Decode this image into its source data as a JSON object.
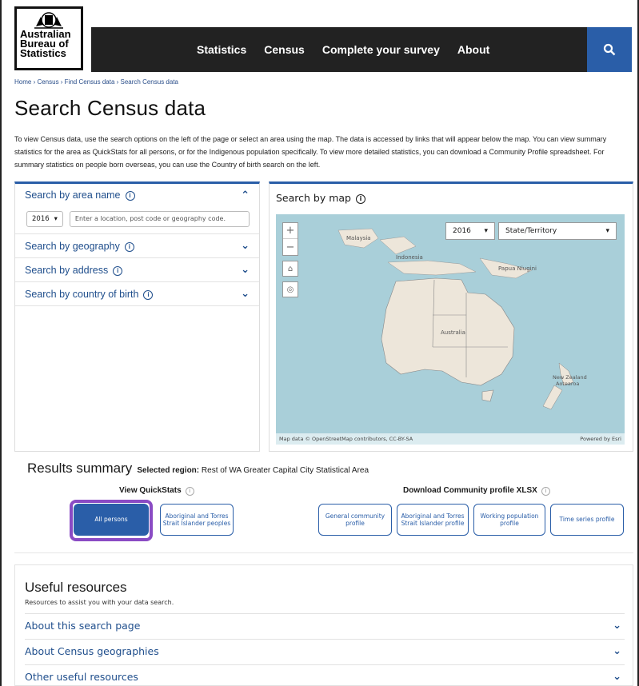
{
  "logo": {
    "line1": "Australian",
    "line2": "Bureau of",
    "line3": "Statistics"
  },
  "nav": {
    "items": [
      "Statistics",
      "Census",
      "Complete your survey",
      "About"
    ]
  },
  "breadcrumb": "Home › Census › Find Census data › Search Census data",
  "page_title": "Search Census data",
  "intro": "To view Census data, use the search options on the left of the page or select an area using the map. The data is accessed by links that will appear below the map. You can view summary statistics for the area as QuickStats for all persons, or for the Indigenous population specifically. To view more detailed statistics, you can download a Community Profile spreadsheet. For summary statistics on people born overseas, you can use the Country of birth search on the left.",
  "left_panel": {
    "area_name_title": "Search by area name",
    "year_value": "2016",
    "search_placeholder": "Enter a location, post code or geography code.",
    "geography_title": "Search by geography",
    "address_title": "Search by address",
    "country_title": "Search by country of birth"
  },
  "map_panel": {
    "title": "Search by map",
    "year_value": "2016",
    "geo_value": "State/Territory",
    "labels": {
      "malaysia": "Malaysia",
      "indonesia": "Indonesia",
      "png": "Papua Niugini",
      "australia": "Australia",
      "nz1": "New Zealand",
      "nz2": "Aotearoa"
    },
    "attribution": "Map data © OpenStreetMap contributors, CC-BY-SA",
    "powered": "Powered by Esri",
    "colors": {
      "sea": "#a9cfd9",
      "land": "#ede6da"
    }
  },
  "results": {
    "title": "Results summary",
    "selected_label": "Selected region:",
    "selected_value": "Rest of WA Greater Capital City Statistical Area",
    "quickstats_heading": "View QuickStats",
    "download_heading": "Download Community profile XLSX",
    "quickstats_buttons": [
      "All persons",
      "Aboriginal and Torres Strait Islander peoples"
    ],
    "profile_buttons": [
      "General community profile",
      "Aboriginal and Torres Strait Islander profile",
      "Working population profile",
      "Time series profile"
    ]
  },
  "useful": {
    "title": "Useful resources",
    "desc": "Resources to assist you with your data search.",
    "items": [
      "About this search page",
      "About Census geographies",
      "Other useful resources"
    ]
  },
  "colors": {
    "nav_bg": "#222222",
    "accent": "#2a5ea8",
    "highlight": "#8a4bc4"
  }
}
